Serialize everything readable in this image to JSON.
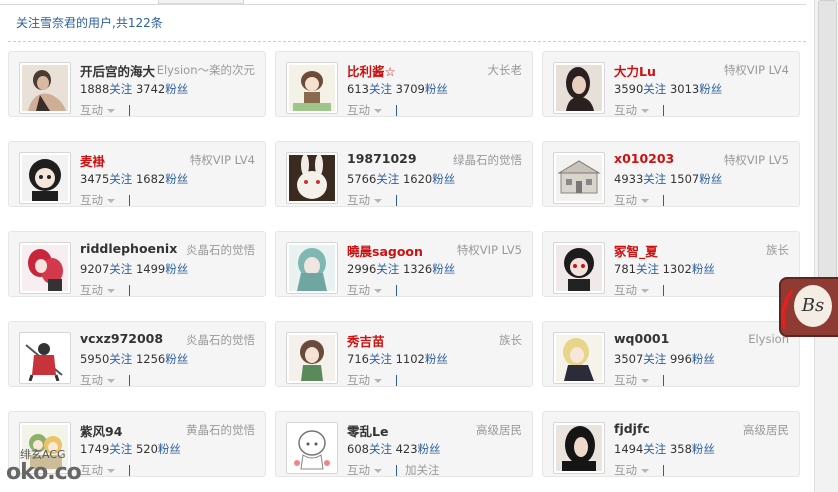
{
  "summary_text": "关注雪奈君的用户,共122条",
  "action_label": "互动",
  "follow_label": "关注",
  "fans_label": "粉丝",
  "add_follow_label": "加关注",
  "users": [
    {
      "name": "开后宫的海大",
      "rank": "Elysion～楽的次元",
      "follow": "1888",
      "fans": "3742",
      "name_color": "dark",
      "avatar": "girl-photo-avatar"
    },
    {
      "name": "比利酱☆",
      "rank": "大长老",
      "follow": "613",
      "fans": "3709",
      "name_color": "red",
      "avatar": "anime-girl-avatar"
    },
    {
      "name": "大力Lu",
      "rank": "特权VIP LV4",
      "follow": "3590",
      "fans": "3013",
      "name_color": "red",
      "avatar": "woman-portrait-avatar"
    },
    {
      "name": "麦褂",
      "rank": "特权VIP LV4",
      "follow": "3475",
      "fans": "1682",
      "name_color": "red",
      "avatar": "anime-dark-hair-avatar"
    },
    {
      "name": "19871029",
      "rank": "绿晶石的觉悟",
      "follow": "5766",
      "fans": "1620",
      "name_color": "dark",
      "avatar": "rabbit-avatar"
    },
    {
      "name": "x010203",
      "rank": "特权VIP LV5",
      "follow": "4933",
      "fans": "1507",
      "name_color": "red",
      "avatar": "building-sketch-avatar"
    },
    {
      "name": "riddlephoenix",
      "rank": "炎晶石的觉悟",
      "follow": "9207",
      "fans": "1499",
      "name_color": "dark",
      "avatar": "red-anime-avatar"
    },
    {
      "name": "曉晨sagoon",
      "rank": "特权VIP LV5",
      "follow": "2996",
      "fans": "1326",
      "name_color": "red",
      "avatar": "teal-hair-avatar"
    },
    {
      "name": "冢智_夏",
      "rank": "族长",
      "follow": "781",
      "fans": "1302",
      "name_color": "red",
      "avatar": "red-eye-anime-avatar"
    },
    {
      "name": "vcxz972008",
      "rank": "炎晶石的觉悟",
      "follow": "5950",
      "fans": "1256",
      "name_color": "dark",
      "avatar": "swordsman-avatar"
    },
    {
      "name": "秀吉苗",
      "rank": "族长",
      "follow": "716",
      "fans": "1102",
      "name_color": "red",
      "avatar": "anime-girl-green-avatar"
    },
    {
      "name": "wq0001",
      "rank": "Elysion",
      "follow": "3507",
      "fans": "996",
      "name_color": "dark",
      "avatar": "blonde-anime-avatar"
    },
    {
      "name": "紫风94",
      "rank": "黄晶石的觉悟",
      "follow": "1749",
      "fans": "520",
      "name_color": "dark",
      "avatar": "chibi-avatar"
    },
    {
      "name": "零乱Le",
      "rank": "高级居民",
      "follow": "608",
      "fans": "423",
      "name_color": "dark",
      "avatar": "sketch-anime-avatar",
      "show_add_follow": true
    },
    {
      "name": "fjdjfc",
      "rank": "高级居民",
      "follow": "1494",
      "fans": "358",
      "name_color": "dark",
      "avatar": "black-hair-girl-avatar"
    }
  ],
  "watermark": {
    "cn": "绯玄ACG",
    "en": "oko.co"
  },
  "side_badge_text": "Bs"
}
